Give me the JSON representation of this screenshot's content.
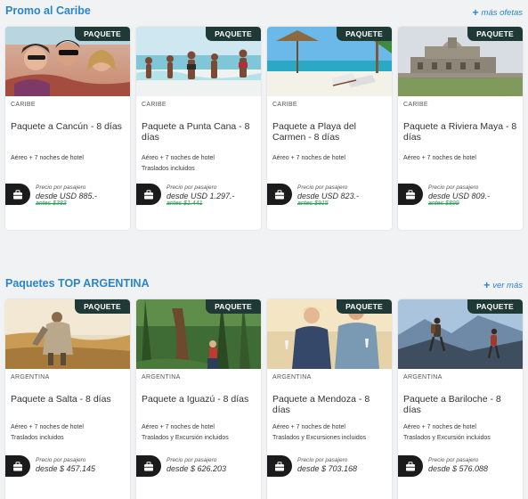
{
  "sections": [
    {
      "title": "Promo al Caribe",
      "link": "más ofetas",
      "cards": [
        {
          "badge": "PAQUETE",
          "region": "CARIBE",
          "title": "Paquete a Cancún - 8 días",
          "lines": [
            "Aéreo + 7 noches de hotel"
          ],
          "price_label": "Precio por pasajero",
          "price": "desde USD 885.-",
          "old_price": "antes $383"
        },
        {
          "badge": "PAQUETE",
          "region": "CARIBE",
          "title": "Paquete a Punta Cana - 8 días",
          "lines": [
            "Aéreo + 7 noches de hotel",
            "Traslados incluidos"
          ],
          "price_label": "Precio por pasajero",
          "price": "desde USD 1.297.-",
          "old_price": "antes $1.441"
        },
        {
          "badge": "PAQUETE",
          "region": "CARIBE",
          "title": "Paquete a Playa del Carmen - 8 días",
          "lines": [
            "Aéreo + 7 noches de hotel"
          ],
          "price_label": "Precio por pasajero",
          "price": "desde USD 823.-",
          "old_price": "antes $915"
        },
        {
          "badge": "PAQUETE",
          "region": "CARIBE",
          "title": "Paquete a Riviera Maya - 8 días",
          "lines": [
            "Aéreo + 7 noches de hotel"
          ],
          "price_label": "Precio por pasajero",
          "price": "desde USD 809.-",
          "old_price": "antes $899"
        }
      ]
    },
    {
      "title": "Paquetes TOP ARGENTINA",
      "link": "ver más",
      "cards": [
        {
          "badge": "PAQUETE",
          "region": "ARGENTINA",
          "title": "Paquete a Salta - 8 días",
          "lines": [
            "Aéreo + 7 noches de hotel",
            "Traslados incluidos"
          ],
          "price_label": "Precio por pasajero",
          "price": "desde $ 457.145"
        },
        {
          "badge": "PAQUETE",
          "region": "ARGENTINA",
          "title": "Paquete a Iguazú - 8 días",
          "lines": [
            "Aéreo + 7 noches de hotel",
            "Traslados y Excursión incluidos"
          ],
          "price_label": "Precio por pasajero",
          "price": "desde $ 626.203"
        },
        {
          "badge": "PAQUETE",
          "region": "ARGENTINA",
          "title": "Paquete a Mendoza - 8 días",
          "lines": [
            "Aéreo + 7 noches de hotel",
            "Traslados y Excursiones incluidos"
          ],
          "price_label": "Precio por pasajero",
          "price": "desde $ 703.168"
        },
        {
          "badge": "PAQUETE",
          "region": "ARGENTINA",
          "title": "Paquete a Bariloche - 8 días",
          "lines": [
            "Aéreo + 7 noches de hotel",
            "Traslados y Excursión incluidos"
          ],
          "price_label": "Precio por pasajero",
          "price": "desde $ 576.088"
        }
      ]
    }
  ],
  "colors": {
    "accent": "#2a86c7",
    "badge_bg": "#1f3a36",
    "old_price": "#2c9a5b"
  },
  "icons": {
    "bag": "suitcase-icon",
    "plus": "plus-icon"
  }
}
